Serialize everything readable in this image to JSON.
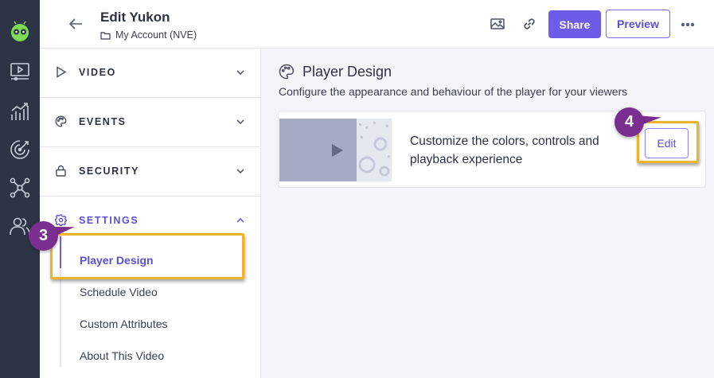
{
  "header": {
    "title": "Edit Yukon",
    "breadcrumb": "My Account (NVE)",
    "share_label": "Share",
    "preview_label": "Preview"
  },
  "sidebar": {
    "sections": [
      {
        "label": "VIDEO",
        "icon": "play-outline-icon"
      },
      {
        "label": "EVENTS",
        "icon": "palette-icon"
      },
      {
        "label": "SECURITY",
        "icon": "lock-icon"
      },
      {
        "label": "SETTINGS",
        "icon": "gear-icon",
        "expanded": true
      }
    ],
    "settings_items": [
      "Player Design",
      "Schedule Video",
      "Custom Attributes",
      "About This Video"
    ],
    "active_item": "Player Design"
  },
  "main": {
    "title": "Player Design",
    "description": "Configure the appearance and behaviour of the player for your viewers",
    "card": {
      "text": "Customize the colors, controls and playback experience",
      "edit_label": "Edit"
    }
  },
  "callouts": {
    "step_settings": "3",
    "step_edit": "4"
  },
  "colors": {
    "accent": "#6c5ce7",
    "rail": "#2c3446",
    "highlight": "#f0b429",
    "callout_badge": "#7a2e8f"
  }
}
